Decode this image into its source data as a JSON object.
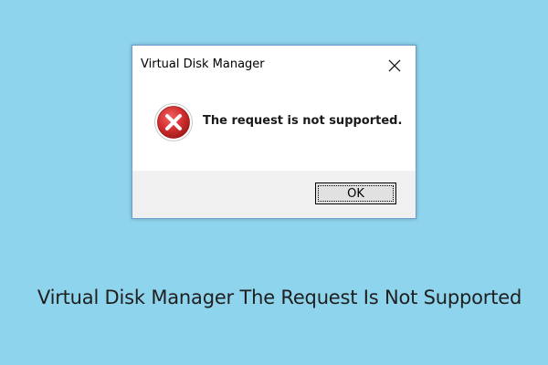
{
  "background_color": "#8ed4ec",
  "dialog": {
    "title": "Virtual Disk Manager",
    "close_icon": "close-icon",
    "icon": "error-icon",
    "message": "The request is not supported.",
    "ok_label": "OK"
  },
  "caption": "Virtual Disk Manager The Request Is Not Supported",
  "colors": {
    "dialog_border": "#6b9ccd",
    "footer": "#f0f0f0",
    "error_red": "#c62828"
  }
}
